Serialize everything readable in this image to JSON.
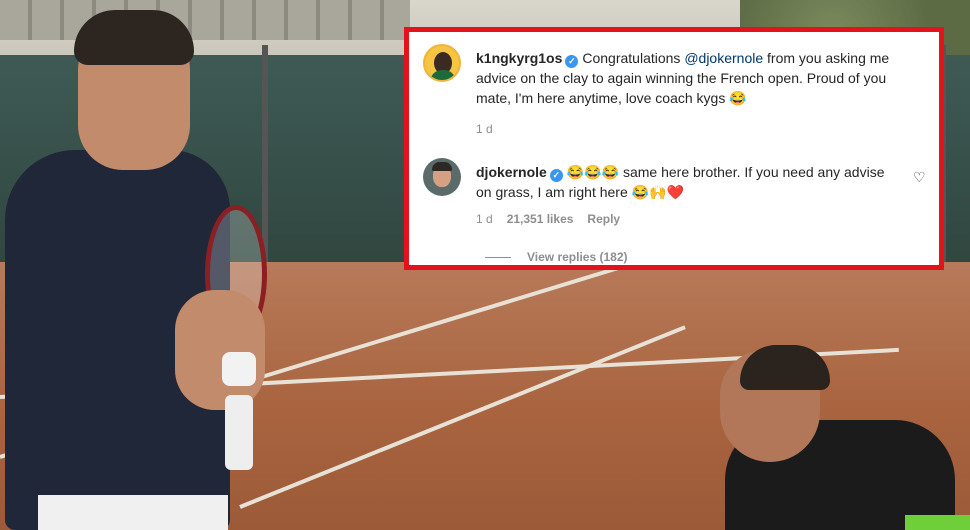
{
  "colors": {
    "highlight_border": "#e3121b",
    "card_background": "#ffffff",
    "text_primary": "#262626",
    "text_secondary": "#8e8e8e",
    "mention": "#00376b",
    "verified_badge": "#3897f0"
  },
  "background_photo": {
    "description_icon": "tennis-court-photo"
  },
  "comments": [
    {
      "username": "k1ngkyrg1os",
      "verified": true,
      "avatar_icon": "avatar-yellow-ring-icon",
      "text_before_mention": "Congratulations ",
      "mention": "@djokernole",
      "text_after_mention": " from you asking me advice on the clay to again winning the French open. Proud of you mate, I'm here anytime, love coach kygs ",
      "trailing_emoji": "😂",
      "age": "1 d"
    },
    {
      "username": "djokernole",
      "verified": true,
      "avatar_icon": "avatar-photo-icon",
      "leading_emojis": "😂😂😂",
      "text": " same here brother. If you need any advise on grass, I am right here ",
      "trailing_emojis": "😂🙌❤️",
      "age": "1 d",
      "likes": "21,351 likes",
      "reply_label": "Reply",
      "like_icon": "heart-outline-icon"
    }
  ],
  "view_replies": {
    "label": "View replies (182)"
  }
}
